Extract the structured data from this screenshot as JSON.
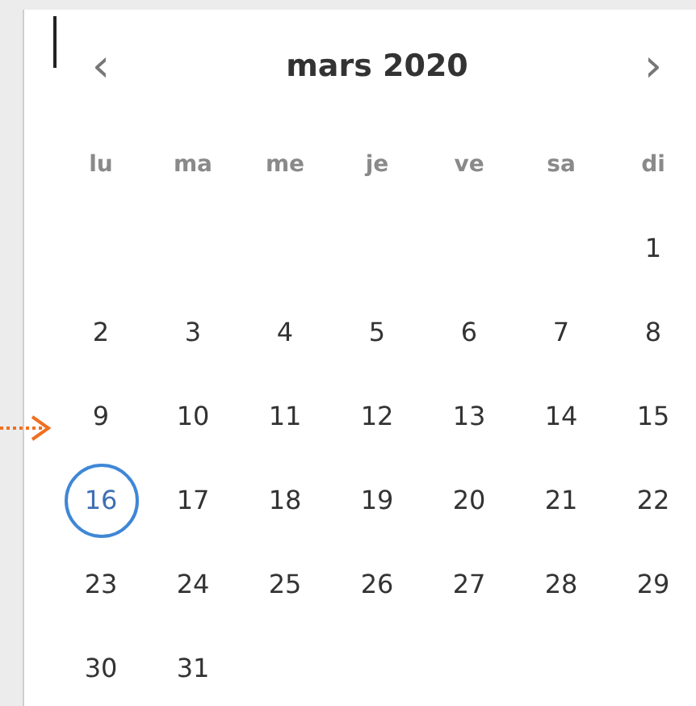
{
  "calendar": {
    "prev": "‹",
    "title": "mars 2020",
    "next": "›",
    "weekdays": [
      "lu",
      "ma",
      "me",
      "je",
      "ve",
      "sa",
      "di"
    ],
    "weeks": [
      {
        "kind": "trailing",
        "days": [
          {
            "label": "1",
            "selected": false
          }
        ]
      },
      {
        "kind": "leading",
        "days": [
          {
            "label": "2",
            "selected": false
          },
          {
            "label": "3",
            "selected": false
          },
          {
            "label": "4",
            "selected": false
          },
          {
            "label": "5",
            "selected": false
          },
          {
            "label": "6",
            "selected": false
          },
          {
            "label": "7",
            "selected": false
          },
          {
            "label": "8",
            "selected": false
          }
        ]
      },
      {
        "kind": "leading",
        "days": [
          {
            "label": "9",
            "selected": false
          },
          {
            "label": "10",
            "selected": false
          },
          {
            "label": "11",
            "selected": false
          },
          {
            "label": "12",
            "selected": false
          },
          {
            "label": "13",
            "selected": false
          },
          {
            "label": "14",
            "selected": false
          },
          {
            "label": "15",
            "selected": false
          }
        ]
      },
      {
        "kind": "leading",
        "days": [
          {
            "label": "16",
            "selected": true
          },
          {
            "label": "17",
            "selected": false
          },
          {
            "label": "18",
            "selected": false
          },
          {
            "label": "19",
            "selected": false
          },
          {
            "label": "20",
            "selected": false
          },
          {
            "label": "21",
            "selected": false
          },
          {
            "label": "22",
            "selected": false
          }
        ]
      },
      {
        "kind": "leading",
        "days": [
          {
            "label": "23",
            "selected": false
          },
          {
            "label": "24",
            "selected": false
          },
          {
            "label": "25",
            "selected": false
          },
          {
            "label": "26",
            "selected": false
          },
          {
            "label": "27",
            "selected": false
          },
          {
            "label": "28",
            "selected": false
          },
          {
            "label": "29",
            "selected": false
          }
        ]
      },
      {
        "kind": "leading",
        "days": [
          {
            "label": "30",
            "selected": false
          },
          {
            "label": "31",
            "selected": false
          }
        ]
      }
    ]
  }
}
